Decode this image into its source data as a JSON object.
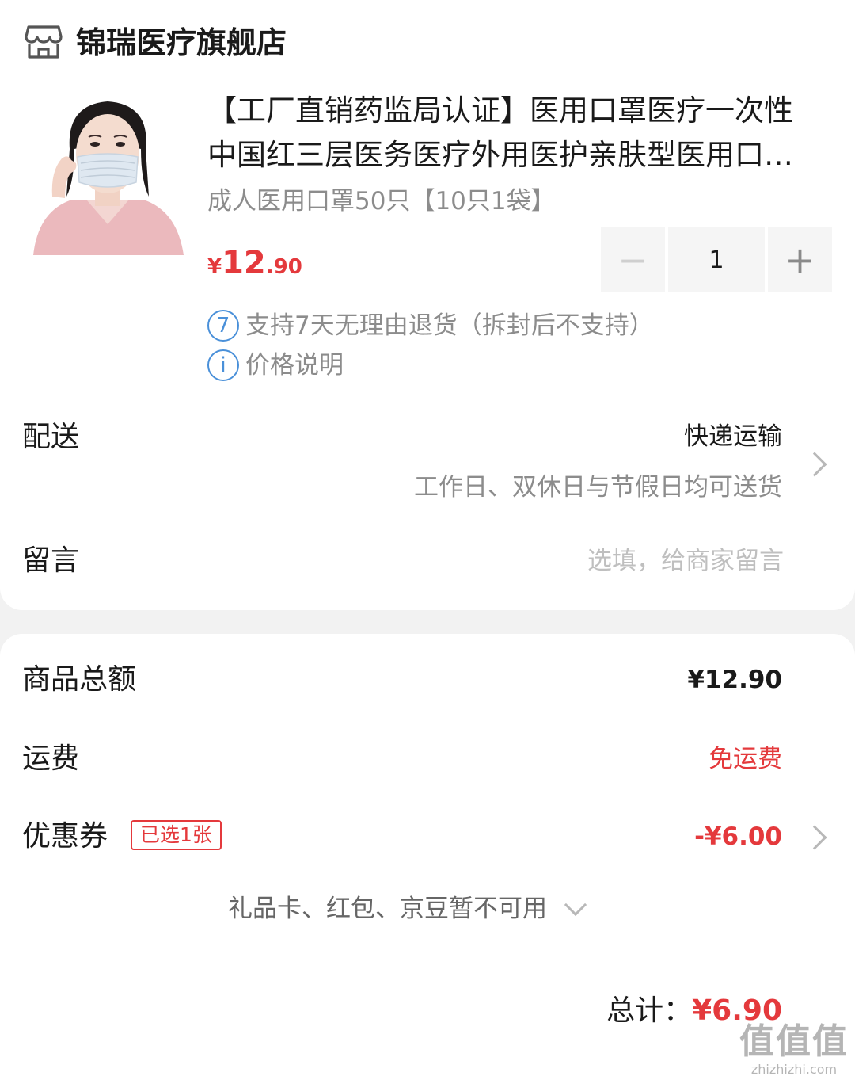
{
  "store": {
    "name": "锦瑞医疗旗舰店",
    "icon": "store-icon"
  },
  "product": {
    "title_line1": "【工厂直销药监局认证】医用口罩医疗一次性",
    "title_line2": "中国红三层医务医疗外用医护亲肤型医用口…",
    "spec": "成人医用口罩50只【10只1袋】",
    "price_symbol": "¥",
    "price_int": "12",
    "price_dec": ".90",
    "quantity": "1",
    "minus": "−",
    "plus": "+",
    "return_policy_icon": "7",
    "return_policy": "支持7天无理由退货（拆封后不支持）",
    "price_note_icon": "i",
    "price_note": "价格说明"
  },
  "delivery": {
    "label": "配送",
    "method": "快递运输",
    "schedule": "工作日、双休日与节假日均可送货"
  },
  "message": {
    "label": "留言",
    "placeholder": "选填，给商家留言"
  },
  "summary": {
    "subtotal_label": "商品总额",
    "subtotal_value": "¥12.90",
    "shipping_label": "运费",
    "shipping_value": "免运费",
    "coupon_label": "优惠券",
    "coupon_badge": "已选1张",
    "coupon_value": "-¥6.00",
    "unavailable": "礼品卡、红包、京豆暂不可用",
    "total_label": "总计：",
    "total_value": "¥6.90"
  },
  "watermark": {
    "logo": "值值值",
    "url": "zhizhizhi.com"
  },
  "colors": {
    "accent_red": "#e4393c",
    "info_blue": "#4a90d9",
    "background": "#f2f2f2"
  }
}
